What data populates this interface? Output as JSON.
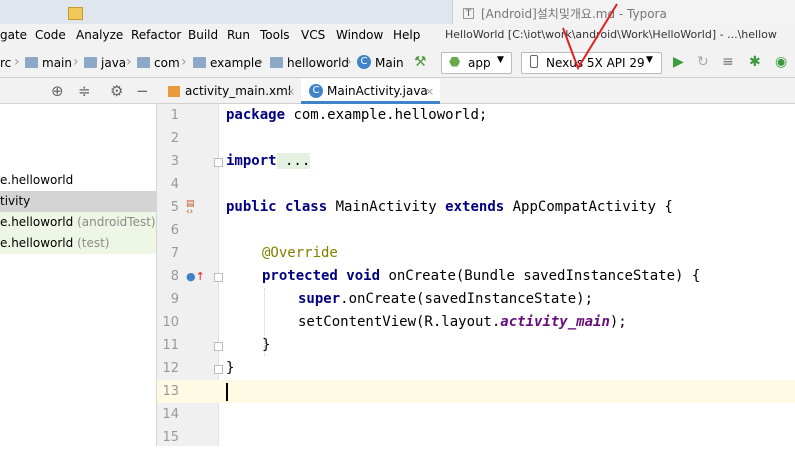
{
  "os_tabs": {
    "typora_title": "[Android]설치및개요.md - Typora",
    "typora_icon": "T"
  },
  "menu": {
    "items": [
      "gate",
      "Code",
      "Analyze",
      "Refactor",
      "Build",
      "Run",
      "Tools",
      "VCS",
      "Window",
      "Help"
    ],
    "window_title": "HelloWorld [C:\\iot\\work\\android\\Work\\HelloWorld] - ...\\hellow"
  },
  "nav": {
    "crumbs": [
      "rc",
      "main",
      "java",
      "com",
      "example",
      "helloworld",
      "Main"
    ],
    "run_config": "app",
    "device": "Nexus 5X API 29"
  },
  "project_tree": [
    {
      "label": "e.helloworld",
      "suffix": ""
    },
    {
      "label": "tivity",
      "suffix": ""
    },
    {
      "label": "e.helloworld",
      "suffix": "(androidTest)"
    },
    {
      "label": "e.helloworld",
      "suffix": "(test)"
    }
  ],
  "tabs": [
    {
      "label": "activity_main.xml"
    },
    {
      "label": "MainActivity.java"
    }
  ],
  "line_numbers": [
    "1",
    "2",
    "3",
    "4",
    "5",
    "6",
    "7",
    "8",
    "9",
    "10",
    "11",
    "12",
    "13",
    "14",
    "15"
  ],
  "code": {
    "l1_kw": "package",
    "l1_rest": " com.example.helloworld;",
    "l3_kw": "import",
    "l3_rest": " ...",
    "l7_kw1": "public class",
    "l7_mid": " MainActivity ",
    "l7_kw2": "extends",
    "l7_rest": " AppCompatActivity {",
    "l9_ann": "@Override",
    "l10_kw": "protected void",
    "l10_rest": " onCreate(Bundle savedInstanceState) {",
    "l11_kw": "super",
    "l11_rest": ".onCreate(savedInstanceState);",
    "l12_pre": "setContentView(R.layout.",
    "l12_it": "activity_main",
    "l12_post": ");",
    "l13": "}",
    "l14": "}"
  },
  "colors": {
    "annotation_red": "#e02020",
    "keyword": "#000080",
    "run_green": "#3d9a3d"
  }
}
